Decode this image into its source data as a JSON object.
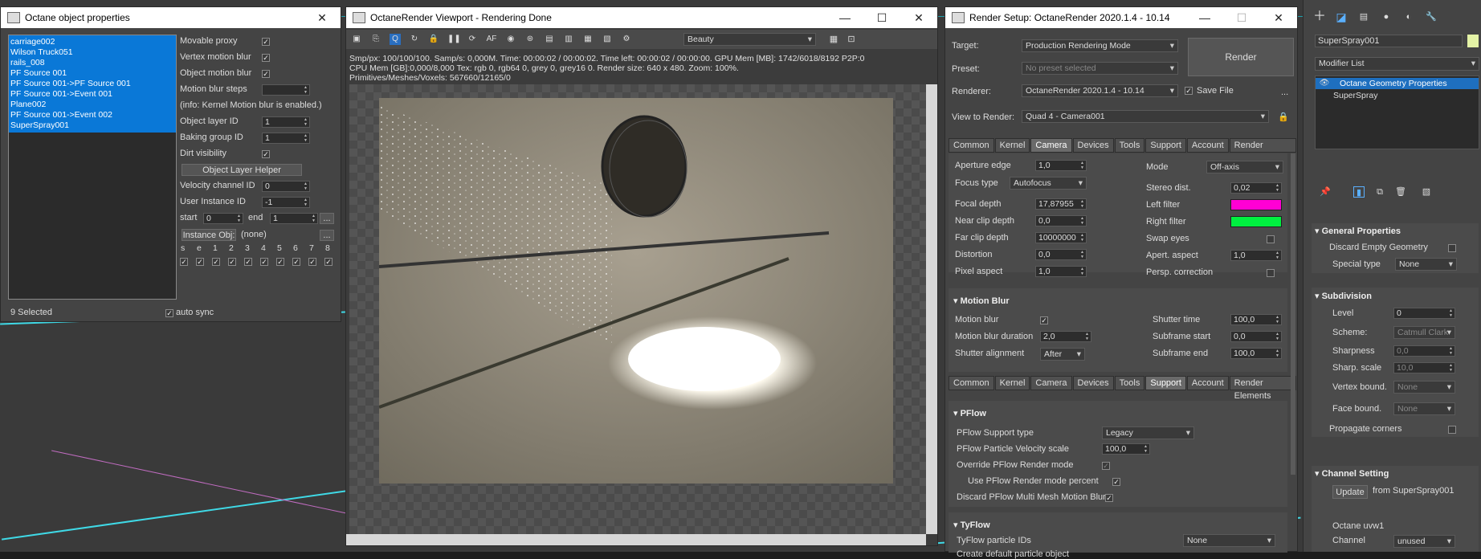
{
  "obj_props": {
    "title": "Octane object properties",
    "list": [
      "carriage002",
      "Wilson Truck051",
      "rails_008",
      "PF Source 001",
      "PF Source 001->PF Source 001",
      "PF Source 001->Event 001",
      "Plane002",
      "PF Source 001->Event 002",
      "SuperSpray001"
    ],
    "labels": {
      "movable_proxy": "Movable proxy",
      "vertex_mb": "Vertex motion blur",
      "object_mb": "Object motion blur",
      "mb_steps": "Motion blur steps",
      "info": "(info: Kernel Motion blur is enabled.)",
      "layer_id": "Object layer ID",
      "baking_id": "Baking group ID",
      "dirt": "Dirt visibility",
      "layer_helper": "Object Layer Helper",
      "velocity": "Velocity channel ID",
      "user_inst": "User Instance ID",
      "start": "start",
      "end": "end",
      "inst_obj": "Instance Obj:",
      "none": "(none)",
      "ellipsis": "...",
      "selected": "9 Selected",
      "auto_sync": "auto sync"
    },
    "values": {
      "layer_id": "1",
      "baking_id": "1",
      "velocity": "0",
      "user_inst": "-1",
      "start": "0",
      "end": "1"
    },
    "channels": [
      "s",
      "e",
      "1",
      "2",
      "3",
      "4",
      "5",
      "6",
      "7",
      "8"
    ]
  },
  "viewport": {
    "title": "OctaneRender Viewport - Rendering Done",
    "pass": "Beauty",
    "stats1": "Smp/px: 100/100/100.   Samp/s: 0,000M.   Time: 00:00:02 / 00:00:02.   Time left: 00:00:02 / 00:00:00.   GPU Mem [MB]: 1742/6018/8192 P2P:0",
    "stats2": "CPU Mem [GB]:0,000/8,000   Tex: rgb 0, rgb64 0, grey 0, grey16 0.   Render size: 640 x 480.   Zoom: 100%.",
    "stats3": "Primitives/Meshes/Voxels: 567660/12165/0"
  },
  "render_setup": {
    "title": "Render Setup: OctaneRender 2020.1.4 - 10.14",
    "target_label": "Target:",
    "target": "Production Rendering Mode",
    "preset_label": "Preset:",
    "preset": "No preset selected",
    "renderer_label": "Renderer:",
    "renderer": "OctaneRender 2020.1.4 - 10.14",
    "save_file": "Save File",
    "render_btn": "Render",
    "more": "...",
    "view_label": "View to Render:",
    "view": "Quad 4 - Camera001",
    "tabs": [
      "Common",
      "Kernel",
      "Camera",
      "Devices",
      "Tools",
      "Support",
      "Account",
      "Render Elements"
    ],
    "camera": {
      "aperture_edge": "Aperture edge",
      "aperture_edge_v": "1,0",
      "focus_type": "Focus type",
      "focus_type_v": "Autofocus",
      "focal_depth": "Focal depth",
      "focal_depth_v": "17,87955",
      "near_clip": "Near clip depth",
      "near_clip_v": "0,0",
      "far_clip": "Far clip depth",
      "far_clip_v": "10000000",
      "distortion": "Distortion",
      "distortion_v": "0,0",
      "pixel_aspect": "Pixel aspect",
      "pixel_aspect_v": "1,0",
      "mode": "Mode",
      "mode_v": "Off-axis",
      "stereo": "Stereo dist.",
      "stereo_v": "0,02",
      "left_filter": "Left filter",
      "right_filter": "Right filter",
      "swap": "Swap eyes",
      "apert_aspect": "Apert. aspect",
      "apert_aspect_v": "1,0",
      "persp": "Persp. correction",
      "left_color": "#ff00d4",
      "right_color": "#00f040"
    },
    "motion_blur": {
      "header": "Motion Blur",
      "mb": "Motion blur",
      "duration": "Motion blur duration",
      "duration_v": "2,0",
      "align": "Shutter alignment",
      "align_v": "After",
      "shutter": "Shutter time",
      "shutter_v": "100,0",
      "sub_start": "Subframe start",
      "sub_start_v": "0,0",
      "sub_end": "Subframe end",
      "sub_end_v": "100,0"
    },
    "pflow": {
      "header": "PFlow",
      "support": "PFlow Support type",
      "support_v": "Legacy",
      "vel_scale": "PFlow Particle Velocity scale",
      "vel_scale_v": "100,0",
      "override": "Override PFlow Render mode",
      "use_percent": "Use PFlow Render mode percent",
      "discard": "Discard PFlow Multi Mesh Motion Blur"
    },
    "tyflow": {
      "header": "TyFlow",
      "ids": "TyFlow particle IDs",
      "ids_v": "None",
      "create": "Create default particle object"
    }
  },
  "modifier": {
    "name": "SuperSpray001",
    "list_label": "Modifier List",
    "stack": [
      "Octane Geometry Properties",
      "SuperSpray"
    ],
    "general": "General Properties",
    "discard_empty": "Discard Empty Geometry",
    "special": "Special type",
    "special_v": "None",
    "subdivision": "Subdivision",
    "level": "Level",
    "level_v": "0",
    "scheme": "Scheme:",
    "scheme_v": "Catmull Clark",
    "sharpness": "Sharpness",
    "sharpness_v": "0,0",
    "sharp_scale": "Sharp. scale",
    "sharp_scale_v": "10,0",
    "vertex_bound": "Vertex bound.",
    "vertex_bound_v": "None",
    "face_bound": "Face bound.",
    "face_bound_v": "None",
    "propagate": "Propagate corners",
    "channel": "Channel Setting",
    "update": "Update",
    "from": "from SuperSpray001",
    "uvw": "Octane uvw1",
    "channel_lbl": "Channel",
    "channel_v": "unused"
  }
}
